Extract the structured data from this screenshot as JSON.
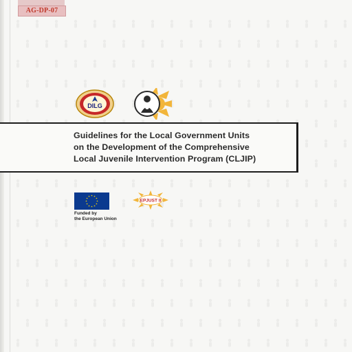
{
  "label": {
    "code": "AG-DP-07"
  },
  "logos": {
    "dilg": "DILG",
    "epjust": "EPJUST II"
  },
  "title": {
    "line1": "Guidelines for the Local Government Units",
    "line2": "on the Development of the Comprehensive",
    "line3": "Local Juvenile Intervention Program (CLJIP)"
  },
  "funding": {
    "line1": "Funded by",
    "line2": "the European Union"
  },
  "colors": {
    "eu_blue": "#0b3a8f",
    "eu_star": "#f5d000",
    "sun_yellow": "#f2b53a",
    "label_red": "#c0392b"
  }
}
